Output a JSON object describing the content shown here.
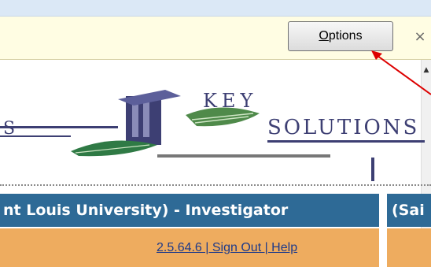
{
  "infobar": {
    "options_label_prefix": "",
    "options_label_accel": "O",
    "options_label_rest": "ptions",
    "close_glyph": "×"
  },
  "logo": {
    "text_main": "KEY",
    "text_sub": "SOLUTIONS",
    "text_left": "S"
  },
  "header": {
    "title": "nt Louis University) - Investigator",
    "title_right": "(Sai"
  },
  "footer": {
    "links_text": "2.5.64.6 | Sign Out | Help"
  },
  "colors": {
    "title_bar": "#2e6a96",
    "orange_bar": "#eeac5f",
    "infobar": "#fffde3",
    "annotation_arrow": "#dd0000"
  }
}
